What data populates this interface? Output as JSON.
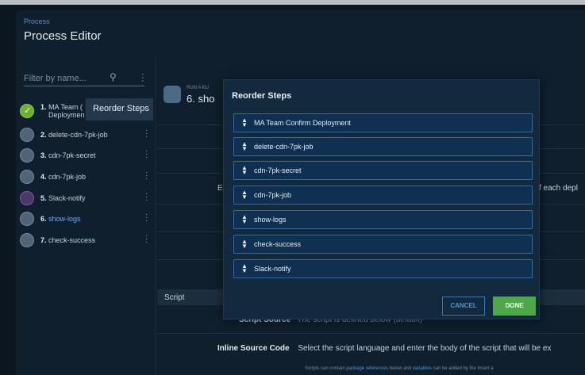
{
  "header": {
    "breadcrumb": "Process",
    "title": "Process Editor"
  },
  "sidebar": {
    "filter_placeholder": "Filter by name...",
    "steps": [
      {
        "num": "1.",
        "line1": "MA Team (",
        "line2": "Deploymen",
        "status": "success"
      },
      {
        "num": "2.",
        "name": "delete-cdn-7pk-job"
      },
      {
        "num": "3.",
        "name": "cdn-7pk-secret"
      },
      {
        "num": "4.",
        "name": "cdn-7pk-job"
      },
      {
        "num": "5.",
        "name": "Slack-notify"
      },
      {
        "num": "6.",
        "name": "show-logs",
        "active": true
      },
      {
        "num": "7.",
        "name": "check-success"
      }
    ],
    "tooltip": "Reorder Steps"
  },
  "main": {
    "run_label": "RUN A KU",
    "run_title": "6. sho",
    "peek_left": "E",
    "peek_right": "f each depl",
    "section": "Script",
    "script_source_label": "Script Source",
    "script_source_value": "The script is defined below",
    "script_source_suffix": "(default)",
    "inline_label": "Inline Source Code",
    "inline_text": "Select the script language and enter the body of the script that will be ex",
    "hint_a": "Scripts can contain ",
    "hint_link1": "package references",
    "hint_b": " below and ",
    "hint_link2": "variables",
    "hint_c": " can be added by the Insert a"
  },
  "modal": {
    "title": "Reorder Steps",
    "items": [
      "MA Team Confirm Deployment",
      "delete-cdn-7pk-job",
      "cdn-7pk-secret",
      "cdn-7pk-job",
      "show-logs",
      "check-success",
      "Slack-notify"
    ],
    "cancel": "CANCEL",
    "done": "DONE"
  },
  "colors": {
    "accent": "#4c96d8",
    "done": "#4ea84a",
    "modal_bg": "#13293d"
  }
}
